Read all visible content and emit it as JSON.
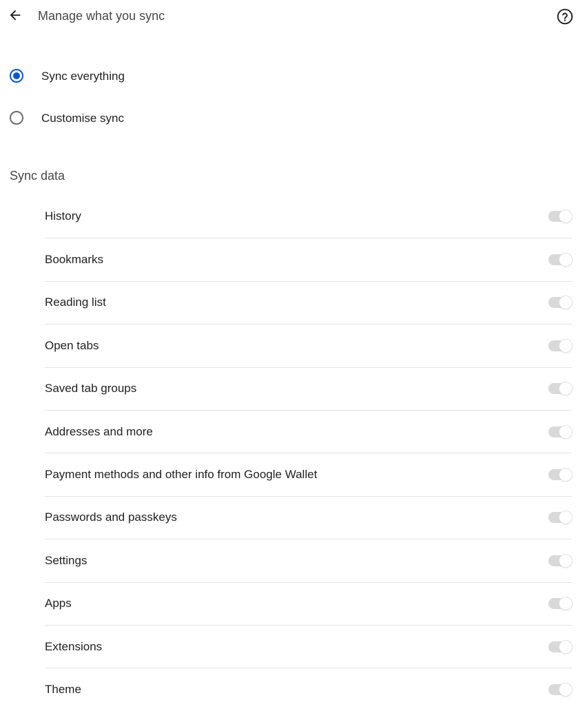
{
  "header": {
    "title": "Manage what you sync",
    "back_icon": "arrow-left-icon",
    "help_icon": "help-circle-icon"
  },
  "sync_mode": {
    "options": [
      {
        "label": "Sync everything",
        "checked": true
      },
      {
        "label": "Customise sync",
        "checked": false
      }
    ],
    "accent_color": "#0b57d0"
  },
  "sync_data": {
    "title": "Sync data",
    "items": [
      {
        "label": "History",
        "on": true,
        "disabled": true
      },
      {
        "label": "Bookmarks",
        "on": true,
        "disabled": true
      },
      {
        "label": "Reading list",
        "on": true,
        "disabled": true
      },
      {
        "label": "Open tabs",
        "on": true,
        "disabled": true
      },
      {
        "label": "Saved tab groups",
        "on": true,
        "disabled": true
      },
      {
        "label": "Addresses and more",
        "on": true,
        "disabled": true
      },
      {
        "label": "Payment methods and other info from Google Wallet",
        "on": true,
        "disabled": true
      },
      {
        "label": "Passwords and passkeys",
        "on": true,
        "disabled": true
      },
      {
        "label": "Settings",
        "on": true,
        "disabled": true
      },
      {
        "label": "Apps",
        "on": true,
        "disabled": true
      },
      {
        "label": "Extensions",
        "on": true,
        "disabled": true
      },
      {
        "label": "Theme",
        "on": true,
        "disabled": true
      }
    ]
  }
}
